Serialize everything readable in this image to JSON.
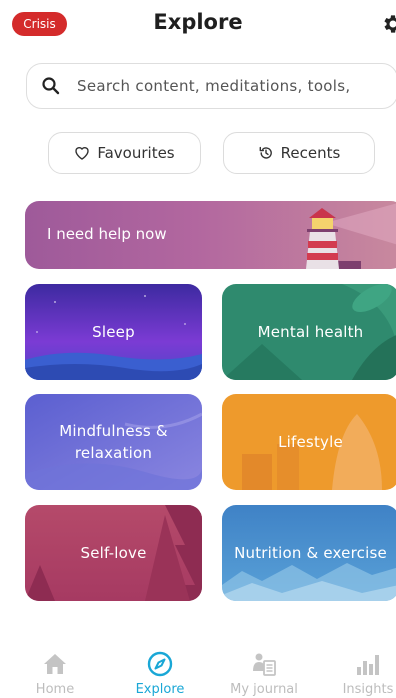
{
  "header": {
    "crisis_label": "Crisis",
    "title": "Explore"
  },
  "search": {
    "placeholder": "Search content, meditations, tools,"
  },
  "filters": {
    "favourites": "Favourites",
    "recents": "Recents"
  },
  "help_banner": {
    "label": "I need help now"
  },
  "categories": [
    {
      "label": "Sleep",
      "color": "#4a3ab0"
    },
    {
      "label": "Mental health",
      "color": "#2f8a6e"
    },
    {
      "label": "Mindfulness & relaxation",
      "color": "#6a6fd0"
    },
    {
      "label": "Lifestyle",
      "color": "#e8902a"
    },
    {
      "label": "Self-love",
      "color": "#b8456a"
    },
    {
      "label": "Nutrition & exercise",
      "color": "#3f86c8"
    }
  ],
  "nav": {
    "items": [
      {
        "label": "Home",
        "icon": "home-icon",
        "active": false
      },
      {
        "label": "Explore",
        "icon": "compass-icon",
        "active": true
      },
      {
        "label": "My journal",
        "icon": "journal-icon",
        "active": false
      },
      {
        "label": "Insights",
        "icon": "bar-chart-icon",
        "active": false
      }
    ],
    "active_color": "#1aa7d6"
  },
  "colors": {
    "crisis": "#d42b2b",
    "accent": "#1aa7d6"
  }
}
